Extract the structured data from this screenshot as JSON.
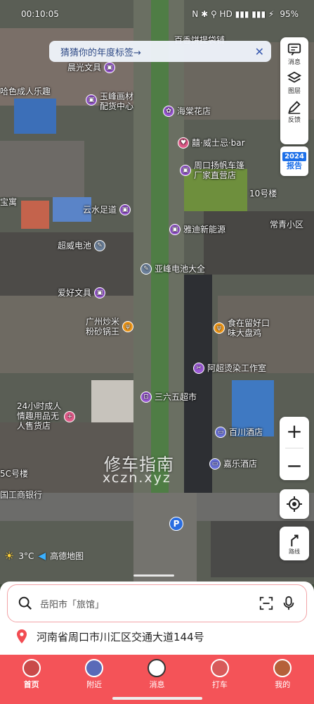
{
  "status_bar": {
    "time": "00:10:05",
    "icons": "N ✱ ⚲ HD ▮▮▮ ▮▮▮ ⚡",
    "battery": "95%"
  },
  "banner": {
    "text": "猜猜你的年度标签→",
    "close": "✕"
  },
  "toolbar": {
    "message": "消息",
    "layers": "图层",
    "feedback": "反馈",
    "report_year": "2024",
    "report_label": "报告"
  },
  "map": {
    "pois": [
      {
        "label": "晨光文具",
        "color": "#9c5ad6",
        "glyph": "▣"
      },
      {
        "label": "玉峰画材",
        "sub": "配货中心",
        "color": "#9c5ad6",
        "glyph": "▣"
      },
      {
        "label": "海棠花店",
        "color": "#9c5ad6",
        "glyph": "✿"
      },
      {
        "label": "囍·威士忌·bar",
        "color": "#e05c8a",
        "glyph": "♥"
      },
      {
        "label": "周口扬帆车篷",
        "sub": "厂家直营店",
        "color": "#9c5ad6",
        "glyph": "▣"
      },
      {
        "label": "云水足道",
        "color": "#9c5ad6",
        "glyph": "▣"
      },
      {
        "label": "雅迪新能源",
        "color": "#9c5ad6",
        "glyph": "▣"
      },
      {
        "label": "超威电池",
        "color": "#6b7f99",
        "glyph": "✎"
      },
      {
        "label": "亚峰电池大全",
        "color": "#6b7f99",
        "glyph": "✎"
      },
      {
        "label": "爱好文具",
        "color": "#9c5ad6",
        "glyph": "▣"
      },
      {
        "label": "广州炒米",
        "sub": "粉砂锅王",
        "color": "#f29a1a",
        "glyph": "ψ"
      },
      {
        "label": "食在留好口",
        "sub": "味大盘鸡",
        "color": "#f29a1a",
        "glyph": "ψ"
      },
      {
        "label": "阿超烫染工作室",
        "color": "#9c5ad6",
        "glyph": "✂"
      },
      {
        "label": "三六五超市",
        "color": "#9c5ad6",
        "glyph": "⊡"
      },
      {
        "label": "24小时成人",
        "sub": "情趣用品无",
        "sub2": "人售货店",
        "color": "#e05c8a",
        "glyph": "+"
      },
      {
        "label": "百川酒店",
        "color": "#6a72d9",
        "glyph": "▭"
      },
      {
        "label": "嘉乐酒店",
        "color": "#6a72d9",
        "glyph": "▭"
      }
    ],
    "plain_labels": [
      "哈色成人乐趣",
      "10号楼",
      "常青小区",
      "宝寓",
      "5C号楼",
      "国工商银行",
      "百香饼提袋铺"
    ],
    "watermark_line1": "修车指南",
    "watermark_line2": "xczn.xyz",
    "parking": "P"
  },
  "weather": {
    "temp": "3°C",
    "brand": "高德地图"
  },
  "search": {
    "placeholder": "岳阳市「旅馆」"
  },
  "address": "河南省周口市川汇区交通大道144号",
  "nav": [
    {
      "label": "首页",
      "color": "#c94a4a",
      "active": true
    },
    {
      "label": "附近",
      "color": "#5a6ab8"
    },
    {
      "label": "消息",
      "color": "#ffffff"
    },
    {
      "label": "打车",
      "color": "#d85a5a"
    },
    {
      "label": "我的",
      "color": "#b5603a"
    }
  ]
}
